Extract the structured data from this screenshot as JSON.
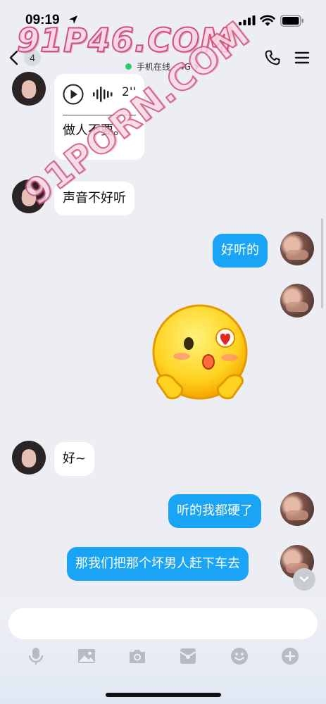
{
  "status_bar": {
    "time": "09:19"
  },
  "header": {
    "unread_count": "4",
    "online_status": "手机在线 - 4G"
  },
  "watermarks": [
    "91P46.COM",
    "91PORN.COM"
  ],
  "messages": [
    {
      "side": "in",
      "type": "voice",
      "duration": "2''",
      "transcript": "做人不要。"
    },
    {
      "side": "in",
      "type": "text",
      "text": "声音不好听"
    },
    {
      "side": "out",
      "type": "text",
      "text": "好听的"
    },
    {
      "side": "out",
      "type": "sticker",
      "sticker": "shy-blushing-emoji"
    },
    {
      "side": "in",
      "type": "text",
      "text": "好~"
    },
    {
      "side": "out",
      "type": "text",
      "text": "听的我都硬了"
    },
    {
      "side": "out",
      "type": "text",
      "text": "那我们把那个坏男人赶下车去"
    }
  ],
  "input": {
    "value": "",
    "placeholder": ""
  },
  "toolbar": [
    "mic-icon",
    "image-icon",
    "camera-icon",
    "red-packet-icon",
    "emoji-icon",
    "plus-icon"
  ],
  "colors": {
    "outgoing_bubble": "#1aa4f5",
    "incoming_bubble": "#ffffff",
    "background": "#eceef3",
    "online_dot": "#2ecc71"
  }
}
